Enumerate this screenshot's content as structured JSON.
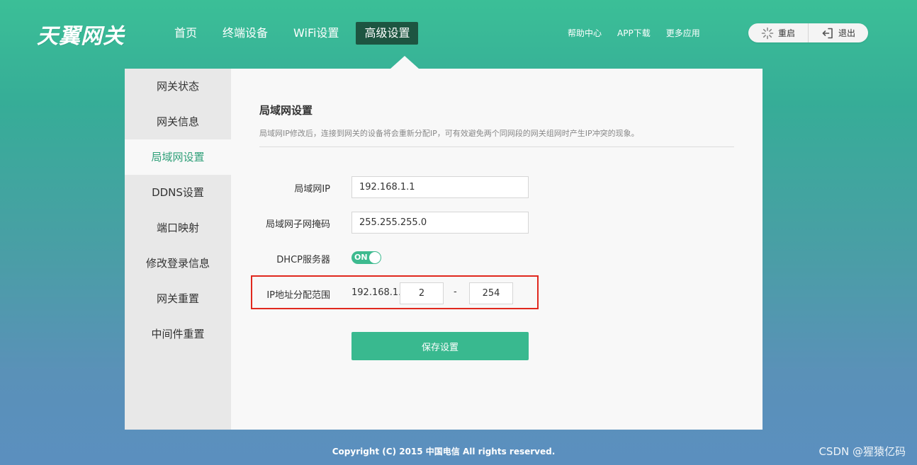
{
  "header": {
    "logo_text": "天翼网关",
    "nav": [
      {
        "label": "首页"
      },
      {
        "label": "终端设备"
      },
      {
        "label": "WiFi设置"
      },
      {
        "label": "高级设置",
        "active": true
      }
    ],
    "links": [
      {
        "label": "帮助中心"
      },
      {
        "label": "APP下载"
      },
      {
        "label": "更多应用"
      }
    ],
    "restart_label": "重启",
    "logout_label": "退出"
  },
  "sidebar": {
    "items": [
      {
        "label": "网关状态"
      },
      {
        "label": "网关信息"
      },
      {
        "label": "局域网设置",
        "active": true
      },
      {
        "label": "DDNS设置"
      },
      {
        "label": "端口映射"
      },
      {
        "label": "修改登录信息"
      },
      {
        "label": "网关重置"
      },
      {
        "label": "中间件重置"
      }
    ]
  },
  "main": {
    "title": "局域网设置",
    "description": "局域网IP修改后，连接到网关的设备将会重新分配IP，可有效避免两个同网段的网关组网时产生IP冲突的现象。",
    "lan_ip": {
      "label": "局域网IP",
      "value": "192.168.1.1"
    },
    "subnet_mask": {
      "label": "局域网子网掩码",
      "value": "255.255.255.0"
    },
    "dhcp": {
      "label": "DHCP服务器",
      "state": "ON"
    },
    "ip_range": {
      "label": "IP地址分配范围",
      "prefix": "192.168.1.",
      "start": "2",
      "separator": "-",
      "end": "254"
    },
    "save_label": "保存设置"
  },
  "footer": {
    "copyright": "Copyright (C) 2015 中国电信 All rights reserved."
  },
  "watermark": "CSDN @猩猿亿码",
  "colors": {
    "accent": "#39b98f",
    "nav_active": "#1d5541",
    "highlight": "#e0281e"
  }
}
